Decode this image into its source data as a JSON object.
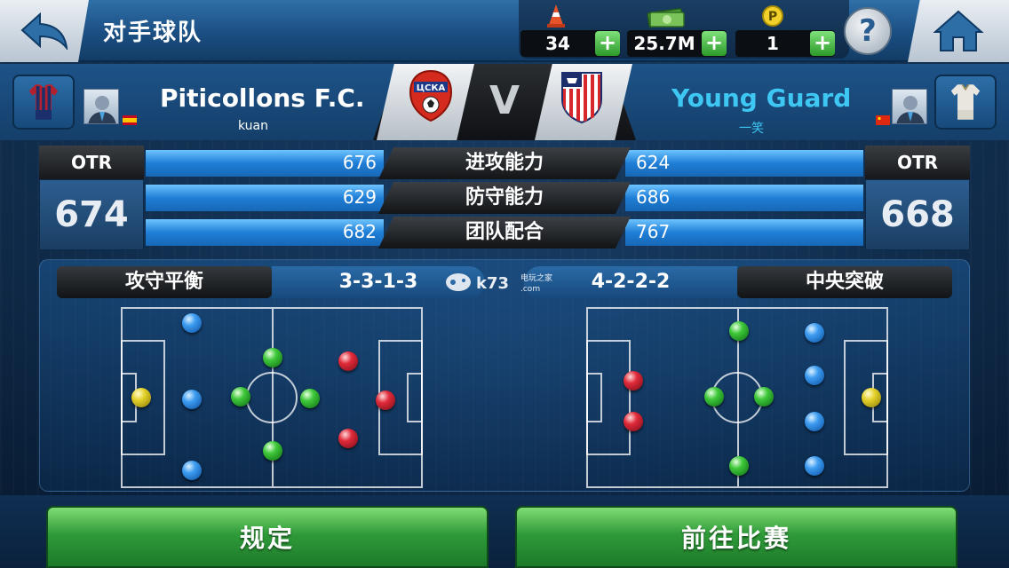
{
  "header": {
    "title": "对手球队",
    "resources": [
      {
        "name": "cone",
        "value": "34",
        "icon": "cone-icon"
      },
      {
        "name": "money",
        "value": "25.7M",
        "icon": "money-icon"
      },
      {
        "name": "points",
        "value": "1",
        "icon": "coin-p-icon"
      }
    ],
    "help_label": "?"
  },
  "match": {
    "home": {
      "name": "Piticollons F.C.",
      "manager": "kuan",
      "flag": "spain",
      "crest": "cska-crest"
    },
    "away": {
      "name": "Young Guard",
      "manager": "一笑",
      "flag": "china",
      "crest": "atletico-crest"
    },
    "vs_label": "V",
    "colors": {
      "away_name": "#3ec7f2",
      "accent": "#1f7ed6"
    }
  },
  "stats": {
    "otr_label": "OTR",
    "home_otr": "674",
    "away_otr": "668",
    "rows": [
      {
        "label": "进攻能力",
        "home": "676",
        "away": "624"
      },
      {
        "label": "防守能力",
        "home": "629",
        "away": "686"
      },
      {
        "label": "团队配合",
        "home": "682",
        "away": "767"
      }
    ]
  },
  "formation": {
    "home_style": "攻守平衡",
    "home_code": "3-3-1-3",
    "away_code": "4-2-2-2",
    "away_style": "中央突破",
    "watermark": "k73 电玩之家 .com"
  },
  "buttons": {
    "rules": "规定",
    "go_match": "前往比赛"
  }
}
